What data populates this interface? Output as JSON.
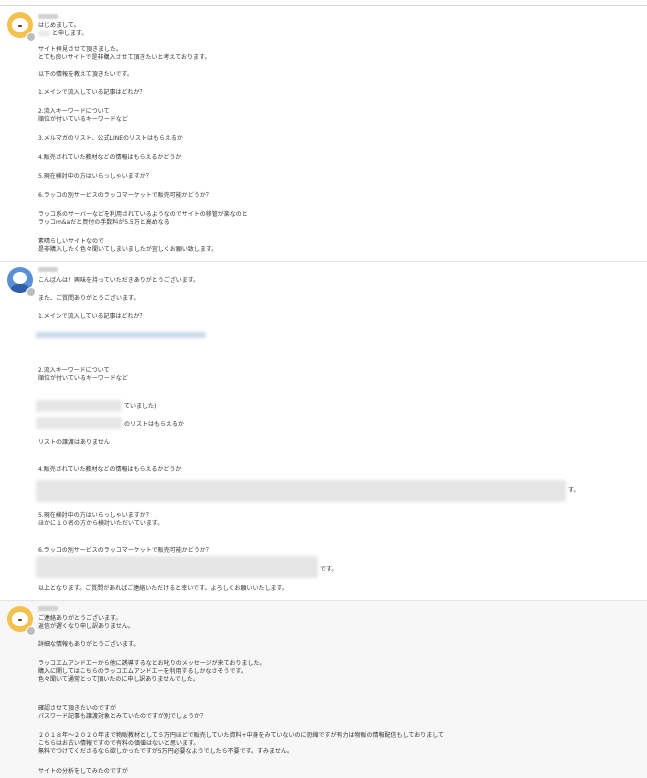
{
  "messages": [
    {
      "id": "m1",
      "sender_avatar": "bear-avatar",
      "lines": [
        "はじめまして。",
        "と申します。",
        "サイト拝見させて頂きました。",
        "とても良いサイトで是非購入させて頂きたいと考えております。",
        "以下の情報を教えて頂きたいです。",
        "1.メインで流入している記事はどれか？",
        "2.流入キーワードについて",
        "順位が付いているキーワードなど",
        "3.メルマガのリスト、公式LINEのリストはもらえるか",
        "4.販売されていた教材などの情報はもらえるかどうか",
        "5.現在検討中の方はいらっしゃいますか？",
        "6.ラッコの別サービスのラッコマーケットで販売可能かどうか？",
        "ラッコ系のサーバーなどを利用されているようなのでサイトの移管が楽なのと",
        "ラッコm&aだと買付の手数料が5.5万と高めなる",
        "素晴らしいサイトなので",
        "是非購入したく色々聞いてしまいましたが宜しくお願い致します。"
      ]
    },
    {
      "id": "m2",
      "sender_avatar": "character-avatar",
      "lines": [
        "こんばんは！興味を持っていただきありがとうございます。",
        "また、ご質問ありがとうございます。",
        "1.メインで流入している記事はどれか？",
        "2.流入キーワードについて",
        "順位が付いているキーワードなど",
        "ていました)",
        "のリストはもらえるか",
        "リストの譲渡はありません",
        "4.販売されていた教材などの情報はもらえるかどうか",
        "す。",
        "5.現在検討中の方はいらっしゃいますか？",
        "ほかに１０名の方から検討いただいています。",
        "6.ラッコの別サービスのラッコマーケットで販売可能かどうか？",
        "です。",
        "以上となります。ご質問があればご連絡いただけると幸いです。よろしくお願いいたします。"
      ]
    },
    {
      "id": "m3",
      "sender_avatar": "bear-avatar",
      "lines": [
        "ご連絡ありがとうございます。",
        "返信が遅くなり申し訳ありません。",
        "詳細な情報もありがとうございます。",
        "ラッコエムアンドエーから他に誘導するなとお叱りのメッセージが来ておりました。",
        "購入に関してはこちらのラッコエムアンドエーを利用するしかなさそうです。",
        "色々聞いて通常とって頂いたのに申し訳ありませんでした。",
        "確認させて頂きたいのですが",
        "パスワード記事も譲渡対象とみていたのですが別でしょうか？",
        "２０１８年～２０２０年まで物販教材として５万円ほどで販売していた資料+中身をみていないのに恐縮ですが有力は物販の情報配信もしておりまして",
        "こちらはお古い情報ですので有料の価値はないと思います。",
        "無料でつけてくださるなら欲しかったですが5万円必要なようでしたら不要です。すみません。",
        "サイトの分析をしてみたのですが"
      ]
    }
  ]
}
